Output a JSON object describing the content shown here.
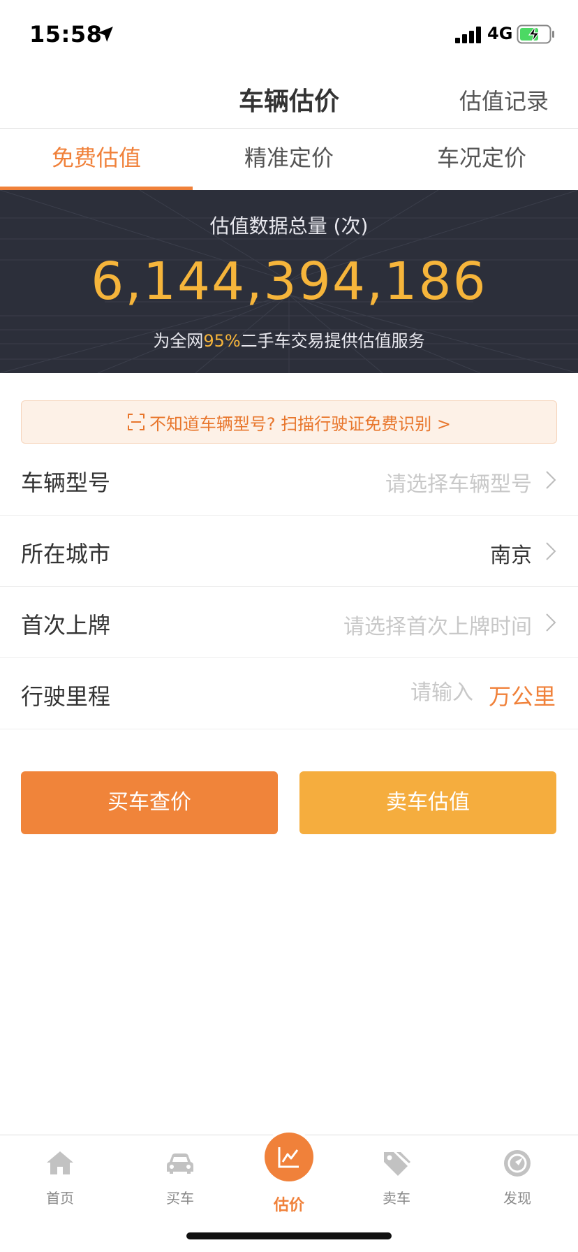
{
  "status_bar": {
    "time": "15:58",
    "network": "4G"
  },
  "nav": {
    "title": "车辆估价",
    "right_action": "估值记录"
  },
  "tabs": [
    {
      "label": "免费估值",
      "active": true
    },
    {
      "label": "精准定价",
      "active": false
    },
    {
      "label": "车况定价",
      "active": false
    }
  ],
  "banner": {
    "title": "估值数据总量 (次)",
    "count": "6,144,394,186",
    "subtitle_prefix": "为全网",
    "subtitle_pct": "95%",
    "subtitle_suffix": "二手车交易提供估值服务"
  },
  "scan_tip": {
    "text": "不知道车辆型号? 扫描行驶证免费识别 >"
  },
  "form": {
    "model": {
      "label": "车辆型号",
      "placeholder": "请选择车辆型号"
    },
    "city": {
      "label": "所在城市",
      "value": "南京"
    },
    "first_reg": {
      "label": "首次上牌",
      "placeholder": "请选择首次上牌时间"
    },
    "mileage": {
      "label": "行驶里程",
      "placeholder": "请输入",
      "unit": "万公里"
    }
  },
  "buttons": {
    "buy_label": "买车查价",
    "sell_label": "卖车估值"
  },
  "tab_bar": {
    "home": "首页",
    "buy": "买车",
    "estimate": "估价",
    "sell": "卖车",
    "discover": "发现"
  },
  "colors": {
    "accent": "#f0813a",
    "accent_light": "#f5ad3e",
    "banner_bg": "#2c2f3a",
    "banner_number": "#f6b53b"
  }
}
